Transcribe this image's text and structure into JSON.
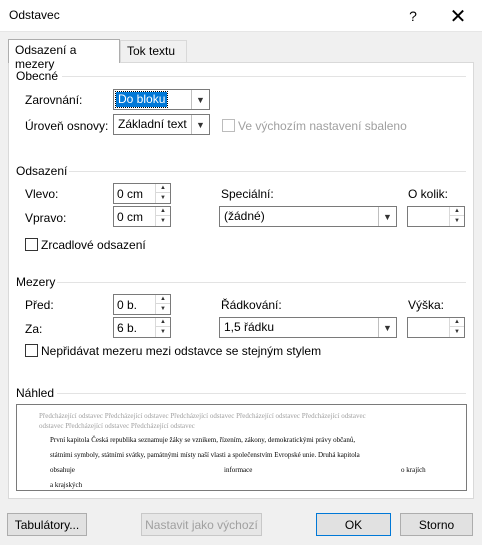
{
  "dialog": {
    "title": "Odstavec",
    "help": "?",
    "close": "✕"
  },
  "tabs": [
    {
      "label": "Odsazení a mezery",
      "active": true
    },
    {
      "label": "Tok textu",
      "active": false
    }
  ],
  "general": {
    "heading": "Obecné",
    "alignment_label": "Zarovnání:",
    "alignment_value": "Do bloku",
    "outline_label": "Úroveň osnovy:",
    "outline_value": "Základní text",
    "collapsed_label": "Ve výchozím nastavení sbaleno"
  },
  "indent": {
    "heading": "Odsazení",
    "left_label": "Vlevo:",
    "left_value": "0 cm",
    "right_label": "Vpravo:",
    "right_value": "0 cm",
    "special_label": "Speciální:",
    "special_value": "(žádné)",
    "by_label": "O kolik:",
    "by_value": "",
    "mirror_label": "Zrcadlové odsazení"
  },
  "spacing": {
    "heading": "Mezery",
    "before_label": "Před:",
    "before_value": "0 b.",
    "after_label": "Za:",
    "after_value": "6 b.",
    "line_label": "Řádkování:",
    "line_value": "1,5 řádku",
    "height_label": "Výška:",
    "height_value": "",
    "no_space_label": "Nepřidávat mezeru mezi odstavce se stejným stylem"
  },
  "preview": {
    "heading": "Náhled",
    "prev_para_1": "Předcházející odstavec Předcházející odstavec Předcházející odstavec Předcházející odstavec Předcházející odstavec",
    "prev_para_2": "odstavec Předcházející odstavec Předcházející odstavec",
    "line_1": "První kapitola Česká republika seznamuje žáky se vznikem, řízením, zákony, demokratickými právy občanů,",
    "line_2": "státními symboly, státními svátky, památnými místy naší vlasti a společenstvím Evropské unie. Druhá kapitola",
    "line_3a": "obsahuje",
    "line_3b": "informace",
    "line_3c": "o krajích",
    "line_4": "a krajských"
  },
  "buttons": {
    "tabs": "Tabulátory...",
    "default": "Nastavit jako výchozí",
    "ok": "OK",
    "cancel": "Storno"
  },
  "colors": {
    "accent": "#0078d7",
    "disabled": "#a0a0a0"
  }
}
